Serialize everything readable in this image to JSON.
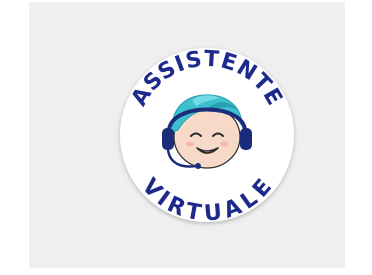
{
  "assistant_badge": {
    "top_text": "ASSISTENTE",
    "bottom_text": "VIRTUALE",
    "icon": "headset-avatar-icon",
    "colors": {
      "background_panel": "#efefef",
      "badge_fill": "#ffffff",
      "text": "#1d2a8c",
      "hair": "#3cc0cf",
      "hair_dark": "#2a9fb0",
      "skin": "#f7d9c7",
      "headset": "#1b2d7a"
    }
  }
}
